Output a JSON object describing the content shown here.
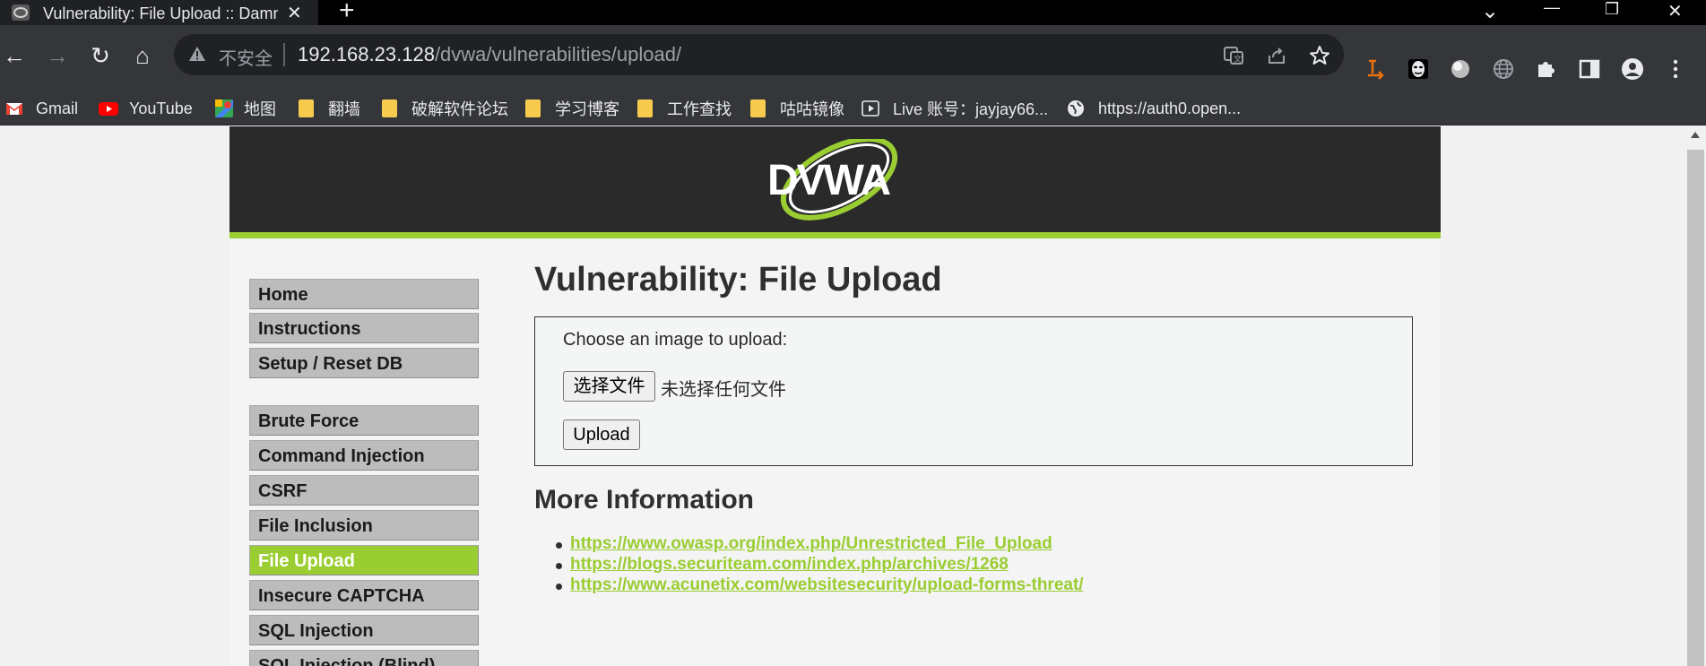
{
  "browser": {
    "tab_title": "Vulnerability: File Upload :: Damn Vulnerable Web Application",
    "tab_close": "✕",
    "new_tab": "+",
    "insecure_label": "不安全",
    "url_host": "192.168.23.128",
    "url_path": "/dvwa/vulnerabilities/upload/",
    "window_controls": {
      "dropdown": "⌄",
      "minimize": "—",
      "restore": "❐",
      "close": "✕"
    },
    "nav": {
      "back": "←",
      "forward": "→",
      "reload": "↻",
      "home": "⌂"
    }
  },
  "bookmarks": [
    {
      "label": "Gmail",
      "icon": "gmail-icon"
    },
    {
      "label": "YouTube",
      "icon": "youtube-icon"
    },
    {
      "label": "地图",
      "icon": "maps-icon"
    },
    {
      "label": "翻墙",
      "icon": "folder-icon"
    },
    {
      "label": "破解软件论坛",
      "icon": "folder-icon"
    },
    {
      "label": "学习博客",
      "icon": "folder-icon"
    },
    {
      "label": "工作查找",
      "icon": "folder-icon"
    },
    {
      "label": "咕咕镜像",
      "icon": "folder-icon"
    },
    {
      "label": "Live  账号：jayjay66...",
      "icon": "live-icon"
    },
    {
      "label": "https://auth0.open...",
      "icon": "globe-icon"
    }
  ],
  "dvwa": {
    "logo_text": "DVWA",
    "menu": [
      {
        "label": "Home"
      },
      {
        "label": "Instructions"
      },
      {
        "label": "Setup / Reset DB"
      },
      {
        "label": "Brute Force"
      },
      {
        "label": "Command Injection"
      },
      {
        "label": "CSRF"
      },
      {
        "label": "File Inclusion"
      },
      {
        "label": "File Upload",
        "active": true
      },
      {
        "label": "Insecure CAPTCHA"
      },
      {
        "label": "SQL Injection"
      },
      {
        "label": "SQL Injection (Blind)"
      }
    ],
    "page_title": "Vulnerability: File Upload",
    "upload_label": "Choose an image to upload:",
    "choose_file_button": "选择文件",
    "no_file_text": "未选择任何文件",
    "upload_button": "Upload",
    "more_info_title": "More Information",
    "links": [
      "https://www.owasp.org/index.php/Unrestricted_File_Upload",
      "https://blogs.securiteam.com/index.php/archives/1268",
      "https://www.acunetix.com/websitesecurity/upload-forms-threat/"
    ]
  },
  "colors": {
    "accent_green": "#9acd32",
    "header_dark": "#2a2a2a",
    "chrome_toolbar": "#35363a"
  }
}
